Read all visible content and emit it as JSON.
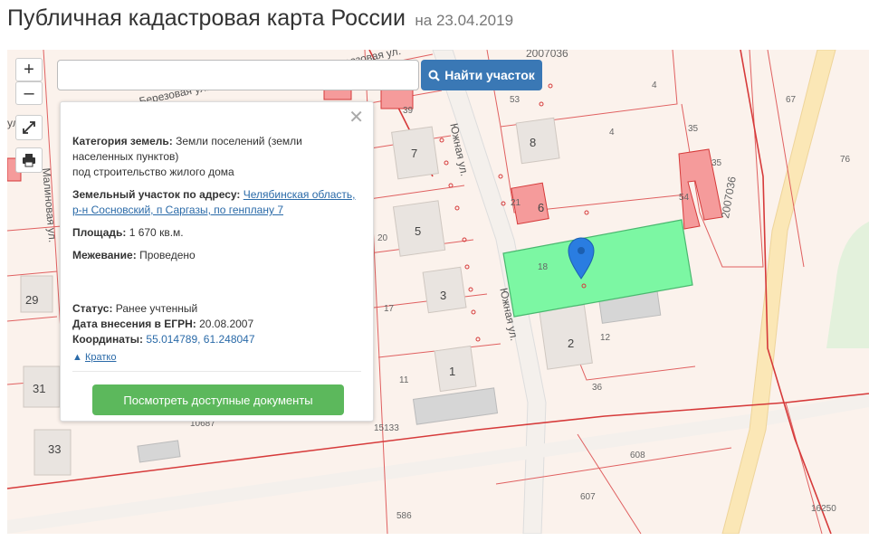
{
  "header": {
    "title": "Публичная кадастровая карта России",
    "date": "на 23.04.2019"
  },
  "search": {
    "placeholder": "",
    "button_label": "Найти участок"
  },
  "controls": {
    "zoom_in": "+",
    "zoom_out": "–"
  },
  "popup": {
    "category_label": "Категория земель:",
    "category_value": "Земли поселений (земли населенных пунктов)",
    "category_sub": "под строительство жилого дома",
    "address_label": "Земельный участок по адресу:",
    "address_value": "Челябинская область, р-н Сосновский, п Саргазы, по генплану 7",
    "area_label": "Площадь:",
    "area_value": "1 670 кв.м.",
    "survey_label": "Межевание:",
    "survey_value": "Проведено",
    "status_label": "Статус:",
    "status_value": "Ранее учтенный",
    "egrn_label": "Дата внесения в ЕГРН:",
    "egrn_value": "20.08.2007",
    "coords_label": "Координаты:",
    "coords_value": "55.014789, 61.248047",
    "brief_label": "Кратко",
    "docs_button": "Посмотреть доступные документы"
  },
  "map_labels": {
    "streets": [
      "Южная ул.",
      "Южная ул.",
      "Березовая ул.",
      "Березовая ул.",
      "Малиновая ул.",
      "ул."
    ],
    "cadastral": [
      "2007036",
      "2007036",
      "15133",
      "10687",
      "16250",
      "586",
      "607",
      "608",
      "36",
      "12",
      "18",
      "53",
      "4",
      "4",
      "67",
      "76",
      "35",
      "35",
      "39",
      "20",
      "17",
      "11",
      "21",
      "54"
    ],
    "houses": [
      "7",
      "5",
      "3",
      "1",
      "8",
      "6",
      "2",
      "29",
      "31",
      "33"
    ]
  },
  "colors": {
    "selected_parcel": "#7cf7a3",
    "parcel_border": "#d63a3a",
    "accent": "#3a78b5",
    "docs_button": "#5cb85c",
    "pin": "#2a7de1"
  }
}
